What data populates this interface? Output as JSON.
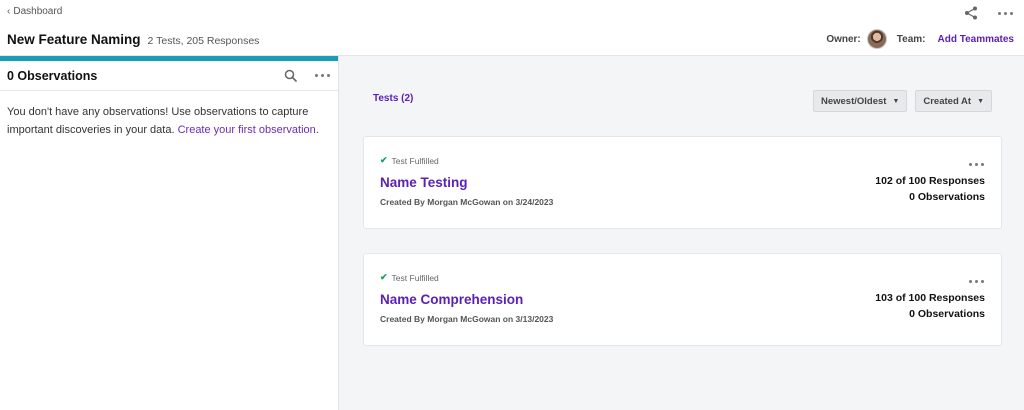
{
  "header": {
    "back_label": "Dashboard",
    "title": "New Feature Naming",
    "subtitle": "2 Tests, 205 Responses",
    "owner_label": "Owner:",
    "team_label": "Team:",
    "add_teammates_label": "Add Teammates",
    "icons": [
      "share-icon",
      "more-icon"
    ]
  },
  "observations": {
    "title": "0 Observations",
    "empty_text": "You don't have any observations! Use observations to capture important discoveries in your data.",
    "create_link": "Create your first observation",
    "create_suffix": ".",
    "icons": [
      "search-icon",
      "more-icon"
    ]
  },
  "tests": {
    "tab_label": "Tests (2)",
    "sort_order_label": "Newest/Oldest",
    "sort_field_label": "Created At",
    "items": [
      {
        "status": "Test Fulfilled",
        "title": "Name Testing",
        "meta": "Created By Morgan McGowan on 3/24/2023",
        "responses": "102 of 100 Responses",
        "observations": "0 Observations"
      },
      {
        "status": "Test Fulfilled",
        "title": "Name Comprehension",
        "meta": "Created By Morgan McGowan on 3/13/2023",
        "responses": "103 of 100 Responses",
        "observations": "0 Observations"
      }
    ]
  },
  "colors": {
    "accent": "#1a9bb8",
    "brand": "#5b21b6",
    "success": "#18a05a"
  }
}
